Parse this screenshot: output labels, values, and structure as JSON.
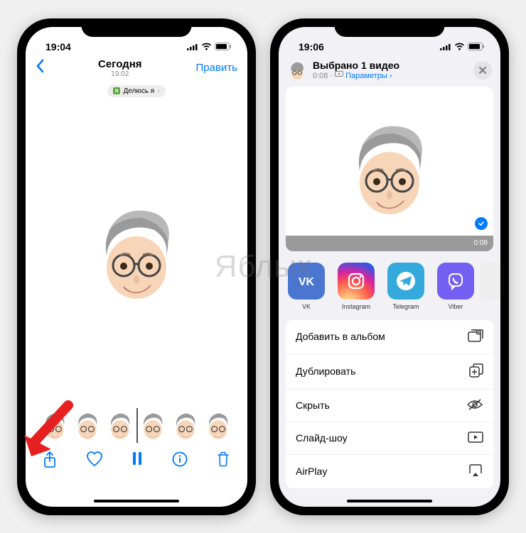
{
  "watermark": "Яблык",
  "phone1": {
    "status": {
      "time": "19:04"
    },
    "nav": {
      "title": "Сегодня",
      "subtitle": "19:02",
      "edit": "Править"
    },
    "badge": {
      "text": "Делюсь я",
      "chevron": "›"
    }
  },
  "phone2": {
    "status": {
      "time": "19:06"
    },
    "header": {
      "title": "Выбрано 1 видео",
      "duration": "0:08",
      "options": "Параметры",
      "chevron": "›"
    },
    "preview": {
      "duration": "0:08"
    },
    "apps": [
      {
        "key": "vk",
        "label": "VK"
      },
      {
        "key": "ig",
        "label": "Instagram"
      },
      {
        "key": "tg",
        "label": "Telegram"
      },
      {
        "key": "vb",
        "label": "Viber"
      }
    ],
    "actions": [
      {
        "label": "Добавить в альбом",
        "icon": "album"
      },
      {
        "label": "Дублировать",
        "icon": "duplicate"
      },
      {
        "label": "Скрыть",
        "icon": "hide"
      },
      {
        "label": "Слайд-шоу",
        "icon": "slideshow"
      },
      {
        "label": "AirPlay",
        "icon": "airplay"
      }
    ]
  }
}
